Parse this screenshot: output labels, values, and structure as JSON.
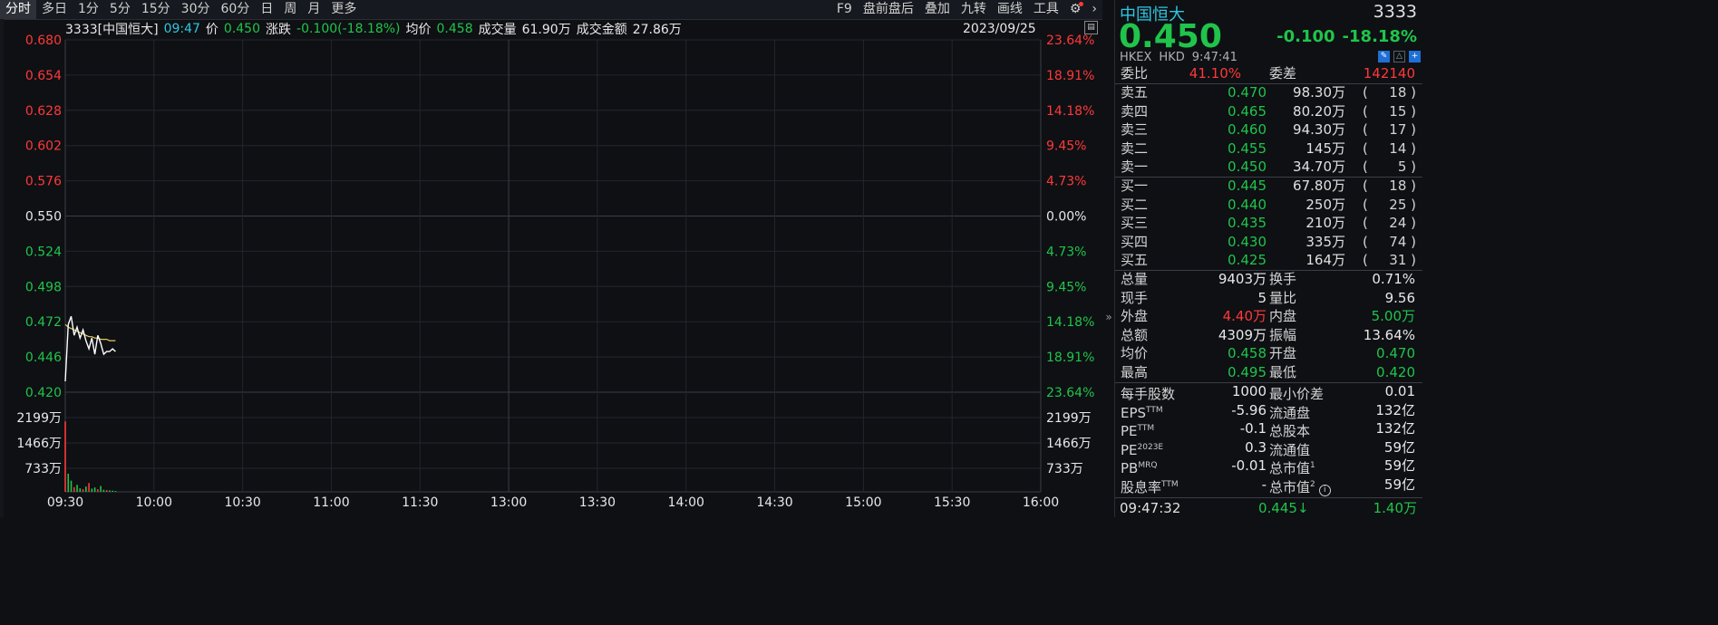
{
  "toolbar": {
    "left": [
      "分时",
      "多日",
      "1分",
      "5分",
      "15分",
      "30分",
      "60分",
      "日",
      "周",
      "月",
      "更多"
    ],
    "right": [
      "F9",
      "盘前盘后",
      "叠加",
      "九转",
      "画线",
      "工具"
    ]
  },
  "infobar": {
    "code_name": "3333[中国恒大]",
    "time": "09:47",
    "price_label": "价",
    "price": "0.450",
    "change_label": "涨跌",
    "change": "-0.100(-18.18%)",
    "avg_label": "均价",
    "avg": "0.458",
    "volume_label": "成交量",
    "volume": "61.90万",
    "amount_label": "成交金额",
    "amount": "27.86万",
    "date": "2023/09/25"
  },
  "chart_data": {
    "type": "line",
    "price_axis_left": [
      "0.680",
      "0.654",
      "0.628",
      "0.602",
      "0.576",
      "0.550",
      "0.524",
      "0.498",
      "0.472",
      "0.446",
      "0.420"
    ],
    "price_axis_right": [
      "23.64%",
      "18.91%",
      "14.18%",
      "9.45%",
      "4.73%",
      "0.00%",
      "4.73%",
      "9.45%",
      "14.18%",
      "18.91%",
      "23.64%"
    ],
    "volume_axis_left": [
      "2199万",
      "1466万",
      "733万"
    ],
    "volume_axis_right": [
      "2199万",
      "1466万",
      "733万"
    ],
    "time_axis": [
      "09:30",
      "10:00",
      "10:30",
      "11:00",
      "11:30",
      "13:00",
      "13:30",
      "14:00",
      "14:30",
      "15:00",
      "15:30",
      "16:00"
    ],
    "ylim": [
      0.42,
      0.68
    ],
    "prev_close": 0.55,
    "vol_max": 2932,
    "price_series": [
      0.428,
      0.47,
      0.476,
      0.462,
      0.468,
      0.46,
      0.466,
      0.458,
      0.452,
      0.46,
      0.448,
      0.462,
      0.456,
      0.448,
      0.45,
      0.45,
      0.452,
      0.45
    ],
    "avg_series": [
      0.47,
      0.468,
      0.467,
      0.466,
      0.465,
      0.464,
      0.463,
      0.462,
      0.461,
      0.461,
      0.46,
      0.46,
      0.459,
      0.459,
      0.459,
      0.458,
      0.458,
      0.458
    ],
    "volume_series": [
      2400,
      620,
      380,
      160,
      240,
      120,
      90,
      180,
      300,
      110,
      150,
      90,
      200,
      70,
      60,
      50,
      40,
      30
    ],
    "volume_colors": [
      "red",
      "green",
      "green",
      "red",
      "green",
      "green",
      "red",
      "green",
      "red",
      "green",
      "green",
      "red",
      "green",
      "green",
      "red",
      "green",
      "green",
      "green"
    ],
    "colors": {
      "price": "#ffffff",
      "avg": "#e6c85a",
      "up": "#ff3838",
      "down": "#20c44a",
      "neutral": "#e8e8e8",
      "grid": "#23262c"
    }
  },
  "panel": {
    "name": "中国恒大",
    "code": "3333",
    "price": "0.450",
    "change": "-0.100",
    "change_pct": "-18.18%",
    "exchange": "HKEX",
    "currency": "HKD",
    "time": "9:47:41",
    "wb_label": "委比",
    "wb": "41.10%",
    "wc_label": "委差",
    "wc": "142140",
    "asks": [
      {
        "label": "卖五",
        "price": "0.470",
        "vol": "98.30万",
        "cnt": "18"
      },
      {
        "label": "卖四",
        "price": "0.465",
        "vol": "80.20万",
        "cnt": "15"
      },
      {
        "label": "卖三",
        "price": "0.460",
        "vol": "94.30万",
        "cnt": "17"
      },
      {
        "label": "卖二",
        "price": "0.455",
        "vol": "145万",
        "cnt": "14"
      },
      {
        "label": "卖一",
        "price": "0.450",
        "vol": "34.70万",
        "cnt": "5"
      }
    ],
    "bids": [
      {
        "label": "买一",
        "price": "0.445",
        "vol": "67.80万",
        "cnt": "18"
      },
      {
        "label": "买二",
        "price": "0.440",
        "vol": "250万",
        "cnt": "25"
      },
      {
        "label": "买三",
        "price": "0.435",
        "vol": "210万",
        "cnt": "24"
      },
      {
        "label": "买四",
        "price": "0.430",
        "vol": "335万",
        "cnt": "74"
      },
      {
        "label": "买五",
        "price": "0.425",
        "vol": "164万",
        "cnt": "31"
      }
    ],
    "stats": [
      {
        "l1": "总量",
        "v1": "9403万",
        "c1": "white",
        "l2": "换手",
        "v2": "0.71%",
        "c2": "white"
      },
      {
        "l1": "现手",
        "v1": "5",
        "c1": "white",
        "l2": "量比",
        "v2": "9.56",
        "c2": "white"
      },
      {
        "l1": "外盘",
        "v1": "4.40万",
        "c1": "red",
        "l2": "内盘",
        "v2": "5.00万",
        "c2": "green"
      },
      {
        "l1": "总额",
        "v1": "4309万",
        "c1": "white",
        "l2": "振幅",
        "v2": "13.64%",
        "c2": "white"
      },
      {
        "l1": "均价",
        "v1": "0.458",
        "c1": "green",
        "l2": "开盘",
        "v2": "0.470",
        "c2": "green"
      },
      {
        "l1": "最高",
        "v1": "0.495",
        "c1": "green",
        "l2": "最低",
        "v2": "0.420",
        "c2": "green"
      }
    ],
    "fundamentals": [
      {
        "l1": "每手股数",
        "s1": "",
        "v1": "1000",
        "l2": "最小价差",
        "s2": "",
        "v2": "0.01"
      },
      {
        "l1": "EPS",
        "s1": "TTM",
        "v1": "-5.96",
        "l2": "流通盘",
        "s2": "",
        "v2": "132亿"
      },
      {
        "l1": "PE",
        "s1": "TTM",
        "v1": "-0.1",
        "l2": "总股本",
        "s2": "",
        "v2": "132亿"
      },
      {
        "l1": "PE",
        "s1": "2023E",
        "v1": "0.3",
        "l2": "流通值",
        "s2": "",
        "v2": "59亿"
      },
      {
        "l1": "PB",
        "s1": "MRQ",
        "v1": "-0.01",
        "l2": "总市值",
        "s2": "1",
        "v2": "59亿"
      },
      {
        "l1": "股息率",
        "s1": "TTM",
        "v1": "-",
        "l2": "总市值",
        "s2": "2",
        "v2": "59亿"
      }
    ],
    "last_trade": {
      "time": "09:47:32",
      "price": "0.445",
      "arrow": "↓",
      "vol": "1.40万"
    }
  }
}
